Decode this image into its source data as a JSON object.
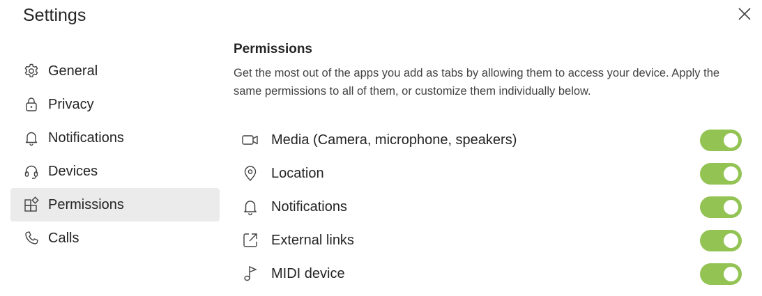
{
  "window": {
    "title": "Settings"
  },
  "sidebar": {
    "items": [
      {
        "label": "General",
        "icon": "gear-icon",
        "active": false
      },
      {
        "label": "Privacy",
        "icon": "lock-icon",
        "active": false
      },
      {
        "label": "Notifications",
        "icon": "bell-icon",
        "active": false
      },
      {
        "label": "Devices",
        "icon": "headset-icon",
        "active": false
      },
      {
        "label": "Permissions",
        "icon": "apps-icon",
        "active": true
      },
      {
        "label": "Calls",
        "icon": "phone-icon",
        "active": false
      }
    ]
  },
  "main": {
    "heading": "Permissions",
    "description": "Get the most out of the apps you add as tabs by allowing them to access your device. Apply the same permissions to all of them, or customize them individually below.",
    "permissions": [
      {
        "label": "Media (Camera, microphone, speakers)",
        "icon": "video-camera-icon",
        "enabled": true
      },
      {
        "label": "Location",
        "icon": "location-pin-icon",
        "enabled": true
      },
      {
        "label": "Notifications",
        "icon": "bell-icon",
        "enabled": true
      },
      {
        "label": "External links",
        "icon": "external-link-icon",
        "enabled": true
      },
      {
        "label": "MIDI device",
        "icon": "music-note-icon",
        "enabled": true
      }
    ]
  },
  "colors": {
    "toggle_on": "#92c353",
    "active_nav_bg": "#ebebeb",
    "text": "#242424"
  }
}
